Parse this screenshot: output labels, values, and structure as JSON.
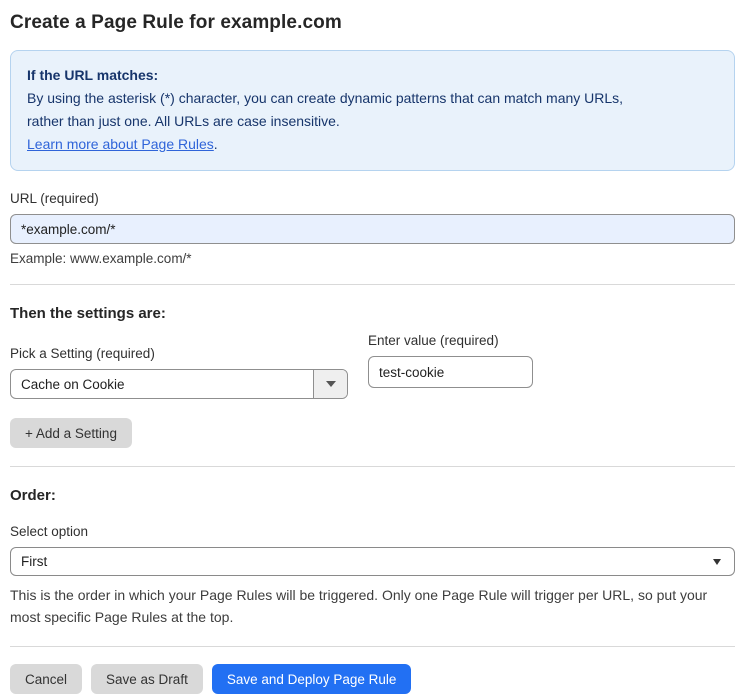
{
  "page": {
    "title": "Create a Page Rule for example.com"
  },
  "info_box": {
    "heading": "If the URL matches:",
    "body_line1": "By using the asterisk (*) character, you can create dynamic patterns that can match many URLs,",
    "body_line2": "rather than just one. All URLs are case insensitive.",
    "link_text": "Learn more about Page Rules",
    "link_suffix": "."
  },
  "url_field": {
    "label": "URL (required)",
    "value": "*example.com/*",
    "example": "Example: www.example.com/*"
  },
  "settings_section": {
    "heading": "Then the settings are:",
    "setting_label": "Pick a Setting (required)",
    "setting_selected": "Cache on Cookie",
    "value_label": "Enter value (required)",
    "value_value": "test-cookie",
    "add_button_label": "+ Add a Setting"
  },
  "order_section": {
    "heading": "Order:",
    "select_label": "Select option",
    "select_selected": "First",
    "help_line1": "This is the order in which your Page Rules will be triggered. Only one Page Rule will trigger per URL, so put your",
    "help_line2": "most specific Page Rules at the top."
  },
  "footer": {
    "cancel_label": "Cancel",
    "save_draft_label": "Save as Draft",
    "save_deploy_label": "Save and Deploy Page Rule"
  },
  "colors": {
    "accent_blue": "#2270f3",
    "info_box_bg": "#e9f2fb",
    "info_box_border": "#b5d3ef",
    "info_text": "#17356b",
    "link_blue": "#2f64d9",
    "url_input_bg": "#e8f0fe",
    "gray_button_bg": "#d9d9d9"
  }
}
